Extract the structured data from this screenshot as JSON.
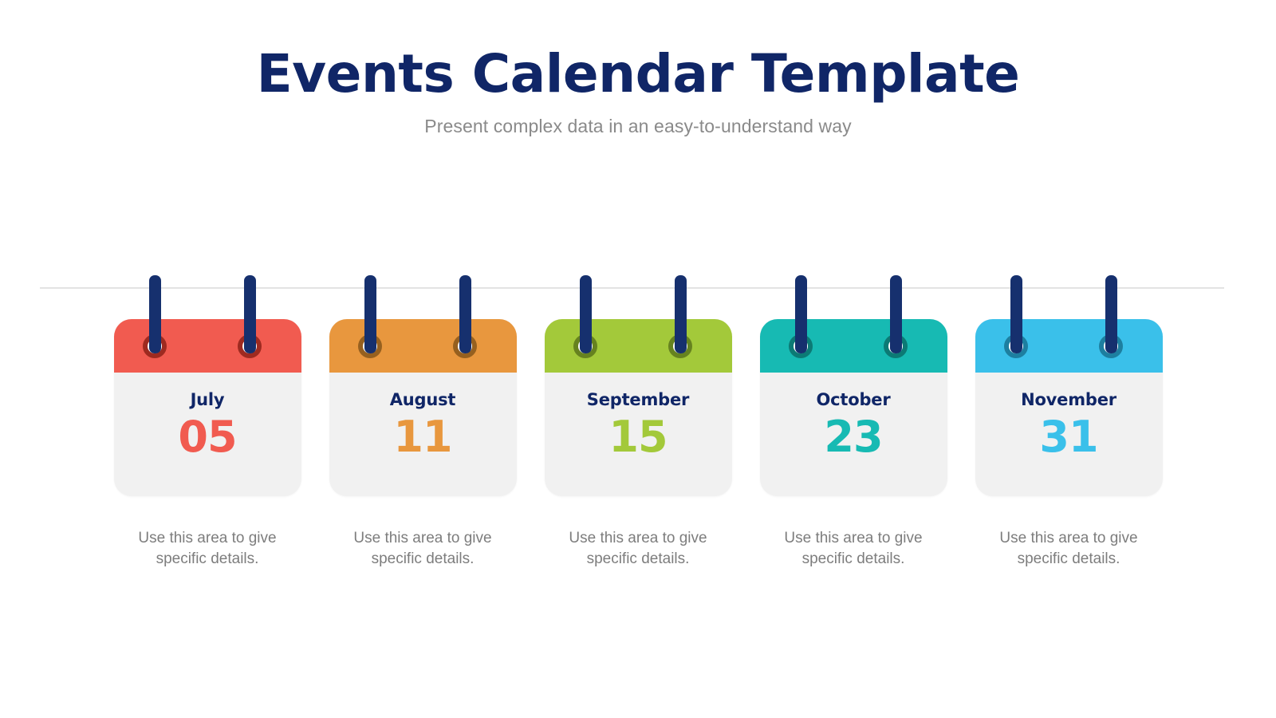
{
  "header": {
    "title": "Events Calendar Template",
    "subtitle": "Present complex data in an easy-to-understand way",
    "title_color": "#102667",
    "subtitle_color": "#8a8a8a"
  },
  "rod": {
    "color": "#e3e3e3"
  },
  "calendars": [
    {
      "month": "July",
      "day": "05",
      "color": "#F15B50",
      "ring_color": "#9e2a20",
      "caption": "Use this area to give specific details."
    },
    {
      "month": "August",
      "day": "11",
      "color": "#E8973E",
      "ring_color": "#96601f",
      "caption": "Use this area to give specific details."
    },
    {
      "month": "September",
      "day": "15",
      "color": "#A3C93A",
      "ring_color": "#66821f",
      "caption": "Use this area to give specific details."
    },
    {
      "month": "October",
      "day": "23",
      "color": "#17BAB3",
      "ring_color": "#0c7a75",
      "caption": "Use this area to give specific details."
    },
    {
      "month": "November",
      "day": "31",
      "color": "#3AC0EA",
      "ring_color": "#1d7fa0",
      "caption": "Use this area to give specific details."
    }
  ],
  "icons": {
    "hanger": "calendar-hanger-icon",
    "ring": "calendar-ring-icon"
  }
}
